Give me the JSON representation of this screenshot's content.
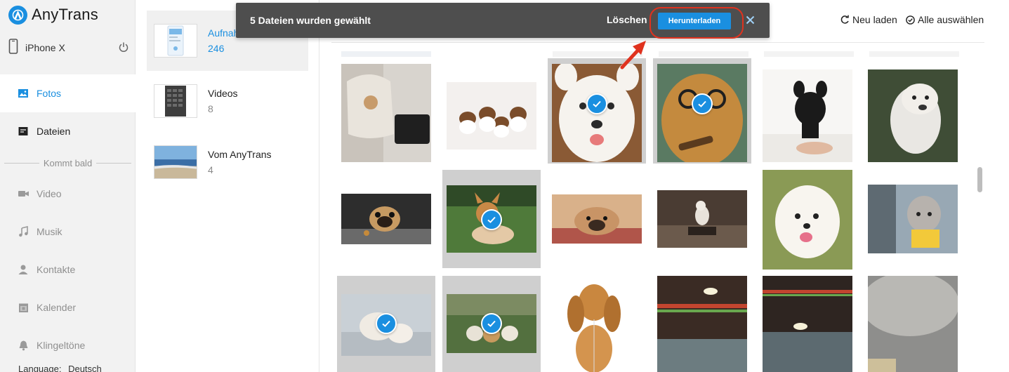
{
  "app": {
    "name": "AnyTrans",
    "brand_color": "#1a8fe0"
  },
  "device": {
    "name": "iPhone X",
    "icon": "phone-icon",
    "power_icon": "power-icon"
  },
  "sidebar": {
    "items": [
      {
        "label": "Fotos",
        "icon": "photo-icon",
        "state": "active"
      },
      {
        "label": "Dateien",
        "icon": "file-icon",
        "state": "normal"
      }
    ],
    "coming_soon_label": "Kommt bald",
    "coming_soon_items": [
      {
        "label": "Video",
        "icon": "video-camera-icon"
      },
      {
        "label": "Musik",
        "icon": "music-note-icon"
      },
      {
        "label": "Kontakte",
        "icon": "contact-icon"
      },
      {
        "label": "Kalender",
        "icon": "calendar-icon"
      },
      {
        "label": "Klingeltöne",
        "icon": "bell-icon"
      }
    ],
    "language_label": "Language:",
    "language_value": "Deutsch"
  },
  "albums": [
    {
      "name": "Aufnahmen",
      "count": "246",
      "selected": true
    },
    {
      "name": "Videos",
      "count": "8",
      "selected": false
    },
    {
      "name": "Vom AnyTrans",
      "count": "4",
      "selected": false
    }
  ],
  "toolbar": {
    "reload_label": "Neu laden",
    "reload_icon": "refresh-icon",
    "select_all_label": "Alle auswählen",
    "select_all_icon": "check-circle-icon"
  },
  "selection_banner": {
    "text": "5 Dateien wurden gewählt",
    "delete_label": "Löschen",
    "download_label": "Herunterladen",
    "close_icon": "close-icon"
  },
  "photos": {
    "selected_count": 5,
    "rows": [
      [
        "cosmetic-bag",
        "puppies",
        "samoyed",
        "dog-glasses",
        "french-bulldog",
        "bulldog"
      ],
      [
        "pug",
        "corgi",
        "pug-lying",
        "small-dog",
        "pomeranian",
        "poodle"
      ],
      [
        "white-puppy",
        "puppies-lawn",
        "cocker-spaniel",
        "ceiling-lamp",
        "ceiling-lamp",
        "blurred"
      ]
    ],
    "selected": [
      [
        0,
        2
      ],
      [
        0,
        3
      ],
      [
        1,
        1
      ],
      [
        2,
        0
      ],
      [
        2,
        1
      ]
    ]
  },
  "colors": {
    "accent": "#1a8fe0",
    "banner": "#4e4e4e",
    "highlight": "#e0321e",
    "selected_tile": "#cfcfcf"
  }
}
